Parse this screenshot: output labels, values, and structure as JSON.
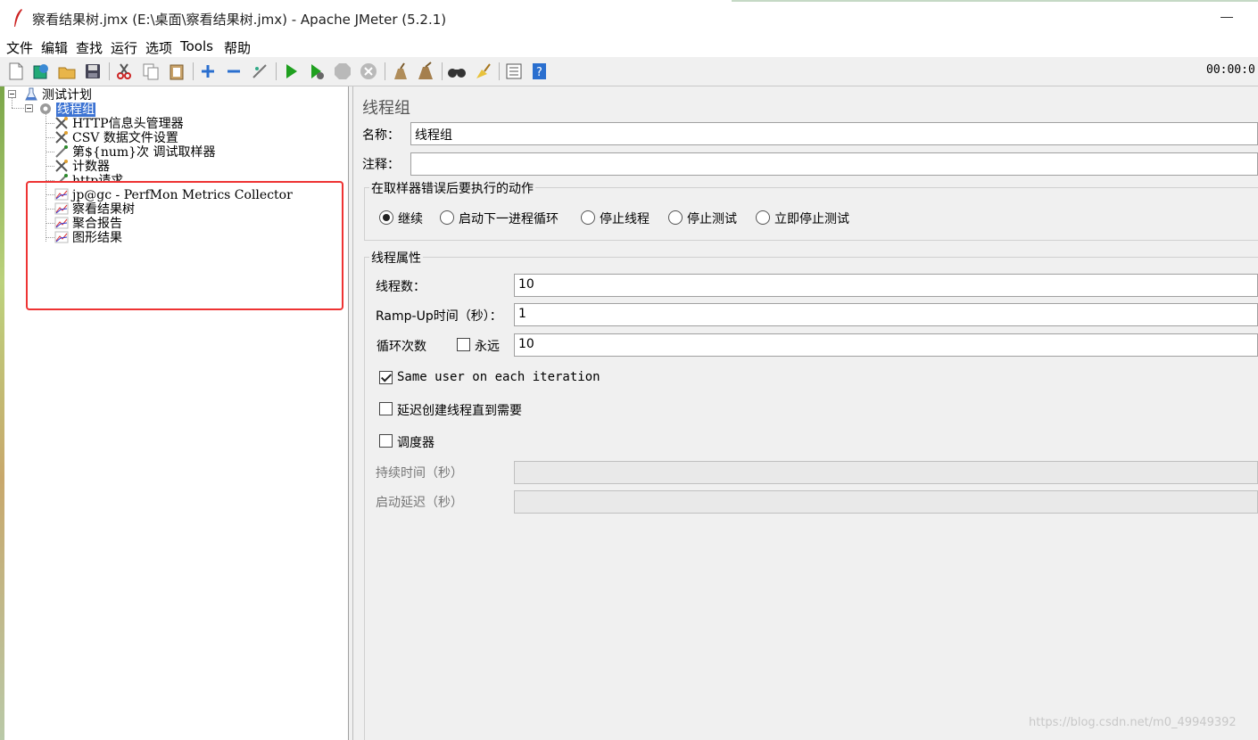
{
  "window": {
    "title": "察看结果树.jmx (E:\\桌面\\察看结果树.jmx) - Apache JMeter (5.2.1)"
  },
  "menu": [
    "文件",
    "编辑",
    "查找",
    "运行",
    "选项",
    "Tools",
    "帮助"
  ],
  "toolbar": {
    "timer": "00:00:0"
  },
  "tree": {
    "root": "测试计划",
    "thread_group": "线程组",
    "children": [
      "HTTP信息头管理器",
      "CSV 数据文件设置",
      "第${num}次 调试取样器",
      "计数器",
      "http请求",
      "jp@gc - PerfMon Metrics Collector",
      "察看结果树",
      "聚合报告",
      "图形结果"
    ]
  },
  "panel": {
    "title": "线程组",
    "name_label": "名称：",
    "name_value": "线程组",
    "comment_label": "注释：",
    "comment_value": "",
    "sampler_error": {
      "title": "在取样器错误后要执行的动作",
      "options": [
        "继续",
        "启动下一进程循环",
        "停止线程",
        "停止测试",
        "立即停止测试"
      ],
      "selected": "继续"
    },
    "thread_props": {
      "title": "线程属性",
      "threads_label": "线程数：",
      "threads_value": "10",
      "rampup_label": "Ramp-Up时间（秒）：",
      "rampup_value": "1",
      "loop_label": "循环次数",
      "forever_label": "永远",
      "forever_checked": false,
      "loop_value": "10",
      "same_user_label": "Same user on each iteration",
      "same_user_checked": true,
      "delay_label": "延迟创建线程直到需要",
      "delay_checked": false,
      "scheduler_label": "调度器",
      "scheduler_checked": false,
      "duration_label": "持续时间（秒）",
      "duration_value": "",
      "startup_delay_label": "启动延迟（秒）",
      "startup_delay_value": ""
    }
  },
  "watermark": "https://blog.csdn.net/m0_49949392",
  "colors": {
    "selection": "#3c73d3",
    "highlight_box": "#ee3333",
    "run_green": "#1fa01f"
  }
}
